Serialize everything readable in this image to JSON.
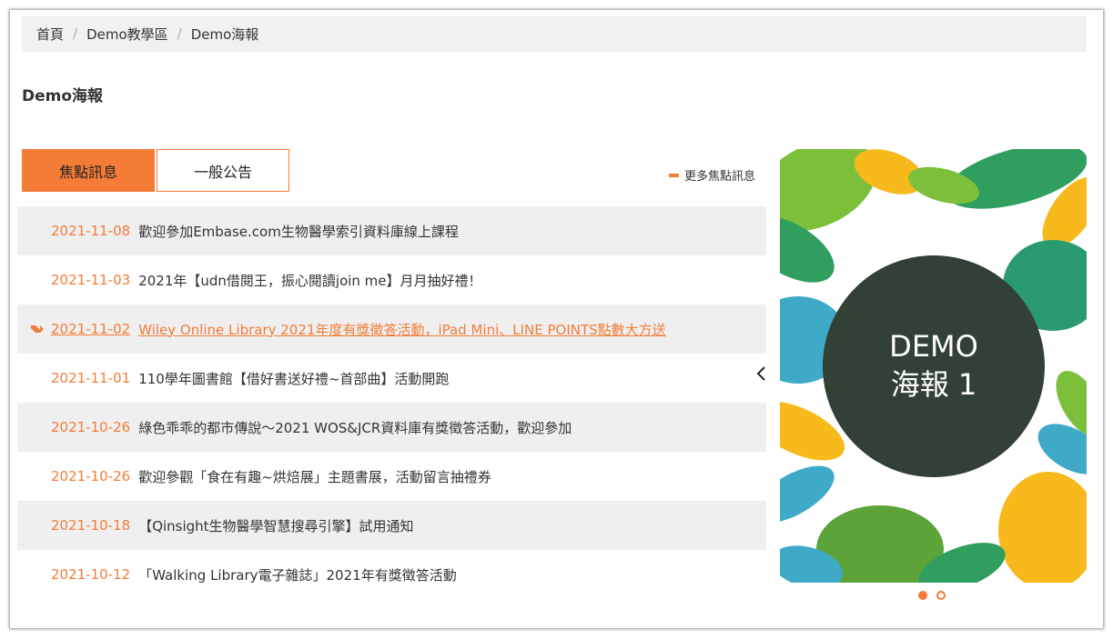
{
  "breadcrumb": {
    "items": [
      "首頁",
      "Demo教學區",
      "Demo海報"
    ],
    "separator": "/"
  },
  "page_title": "Demo海報",
  "tabs": [
    {
      "label": "焦點訊息",
      "active": true
    },
    {
      "label": "一般公告",
      "active": false
    }
  ],
  "more_link": "更多焦點訊息",
  "news": [
    {
      "date": "2021-11-08",
      "title": "歡迎參加Embase.com生物醫學索引資料庫線上課程"
    },
    {
      "date": "2021-11-03",
      "title": "2021年【udn借閱王，振心閱讀join me】月月抽好禮！"
    },
    {
      "date": "2021-11-02",
      "title": "Wiley Online Library 2021年度有獎徵答活動，iPad Mini、LINE POINTS點數大方送"
    },
    {
      "date": "2021-11-01",
      "title": "110學年圖書館【借好書送好禮~首部曲】活動開跑"
    },
    {
      "date": "2021-10-26",
      "title": "綠色乖乖的都市傳說～2021 WOS&JCR資料庫有獎徵答活動，歡迎參加"
    },
    {
      "date": "2021-10-26",
      "title": "歡迎參觀「食在有趣~烘焙展」主題書展，活動留言抽禮券"
    },
    {
      "date": "2021-10-18",
      "title": "【Qinsight生物醫學智慧搜尋引擎】試用通知"
    },
    {
      "date": "2021-10-12",
      "title": "「Walking Library電子雜誌」2021年有獎徵答活動"
    }
  ],
  "poster": {
    "line1": "DEMO",
    "line2": "海報 1"
  },
  "colors": {
    "accent": "#f47c36",
    "row_shade": "#efefef",
    "poster_circle": "#324035"
  }
}
